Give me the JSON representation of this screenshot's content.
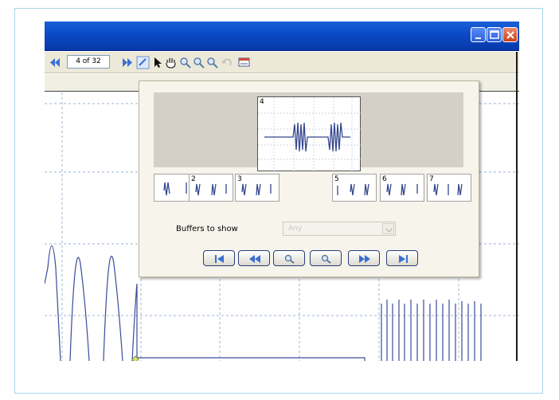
{
  "toolbar": {
    "page_indicator": "4 of 32"
  },
  "popup": {
    "main_thumbnail_number": "4",
    "thumbnails": [
      {
        "number": ""
      },
      {
        "number": "2"
      },
      {
        "number": "3"
      },
      {
        "number": "5"
      },
      {
        "number": "6"
      },
      {
        "number": "7"
      }
    ],
    "buffers_label": "Buffers to show",
    "buffers_value": "Any",
    "nav_buttons": [
      "first-buffer",
      "previous-buffer",
      "zoom-in",
      "zoom-out",
      "next-buffer",
      "last-buffer"
    ]
  },
  "colors": {
    "titlebar": "#0a49c6",
    "waveform": "#3a4c9a",
    "popup_bg": "#f6f4eb",
    "grid": "#9db4cf"
  }
}
